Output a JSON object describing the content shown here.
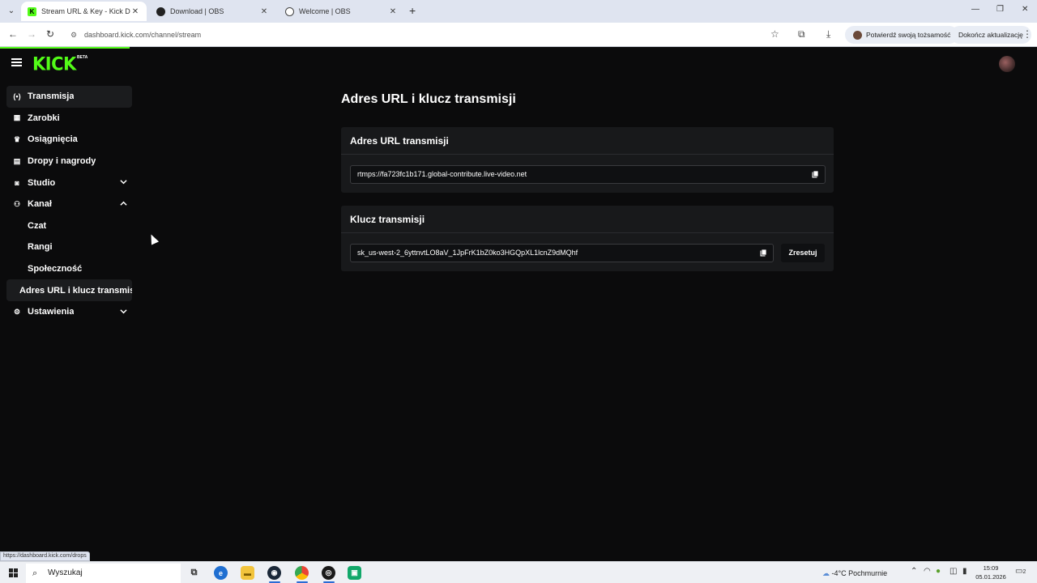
{
  "browser": {
    "tabs": [
      {
        "title": "Stream URL & Key - Kick Dashb",
        "favicon": "kick-icon",
        "active": true
      },
      {
        "title": "Download | OBS",
        "favicon": "obs-icon",
        "active": false
      },
      {
        "title": "Welcome | OBS",
        "favicon": "obs-icon",
        "active": false
      }
    ],
    "url": "dashboard.kick.com/channel/stream",
    "verify_label": "Potwierdź swoją tożsamość",
    "update_label": "Dokończ aktualizację",
    "status_url": "https://dashboard.kick.com/drops"
  },
  "app": {
    "logo": "KICK",
    "logo_badge": "BETA",
    "accent_color": "#53fc18"
  },
  "sidebar": {
    "items": [
      {
        "label": "Transmisja",
        "icon": "broadcast-icon"
      },
      {
        "label": "Zarobki",
        "icon": "earnings-icon"
      },
      {
        "label": "Osiągnięcia",
        "icon": "trophy-icon"
      },
      {
        "label": "Dropy i nagrody",
        "icon": "gift-icon"
      },
      {
        "label": "Studio",
        "icon": "studio-icon"
      },
      {
        "label": "Kanał",
        "icon": "channel-icon"
      },
      {
        "label": "Czat"
      },
      {
        "label": "Rangi"
      },
      {
        "label": "Społeczność"
      },
      {
        "label": "Adres URL i klucz transmisji"
      },
      {
        "label": "Ustawienia",
        "icon": "gear-icon"
      }
    ]
  },
  "main": {
    "title": "Adres URL i klucz transmisji",
    "url_card": {
      "heading": "Adres URL transmisji",
      "value": "rtmps://fa723fc1b171.global-contribute.live-video.net"
    },
    "key_card": {
      "heading": "Klucz transmisji",
      "value": "sk_us-west-2_6yttnvtLO8aV_1JpFrK1bZ0ko3HGQpXL1lcnZ9dMQhf",
      "reset_label": "Zresetuj"
    }
  },
  "taskbar": {
    "search_placeholder": "Wyszukaj",
    "weather": "-4°C  Pochmurnie",
    "time": "15:09",
    "date": "05.01.2026",
    "notifications": "2"
  }
}
